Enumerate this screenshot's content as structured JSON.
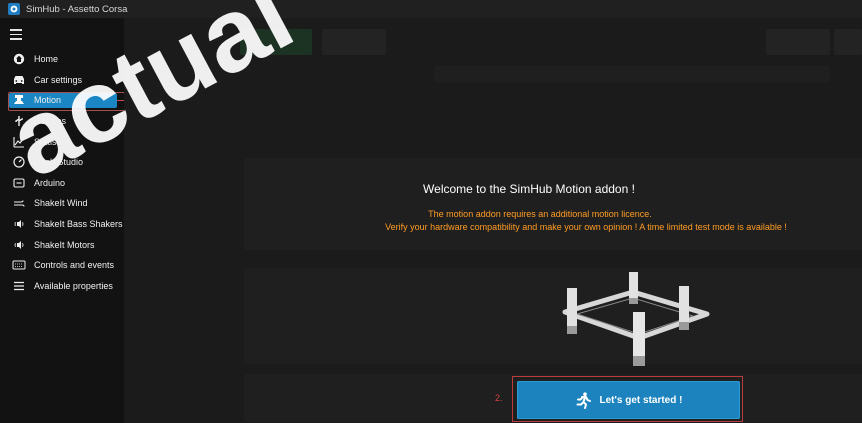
{
  "window": {
    "title": "SimHub - Assetto Corsa"
  },
  "sidebar": {
    "items": [
      {
        "label": "Home",
        "icon": "home-icon"
      },
      {
        "label": "Car settings",
        "icon": "car-icon"
      },
      {
        "label": "Motion",
        "icon": "motion-icon",
        "active": true
      },
      {
        "label": "Devices",
        "icon": "usb-icon"
      },
      {
        "label": "Statistics",
        "icon": "statistics-icon"
      },
      {
        "label": "Dash Studio",
        "icon": "dash-icon"
      },
      {
        "label": "Arduino",
        "icon": "arduino-icon"
      },
      {
        "label": "ShakeIt Wind",
        "icon": "wind-icon"
      },
      {
        "label": "ShakeIt Bass Shakers",
        "icon": "speaker-icon"
      },
      {
        "label": "ShakeIt Motors",
        "icon": "motor-icon"
      },
      {
        "label": "Controls and events",
        "icon": "keyboard-icon"
      },
      {
        "label": "Available properties",
        "icon": "list-icon"
      }
    ]
  },
  "overlay": {
    "welcome_title": "Welcome to the SimHub Motion addon !",
    "licence_note": "The motion addon requires an additional motion licence.",
    "verify_note": "Verify your hardware compatibility and make your own opinion ! A time limited test mode is available !",
    "start_button": "Let's get started !",
    "step_number": "2."
  },
  "watermark": {
    "text": "actual"
  },
  "colors": {
    "accent": "#1a86c4",
    "orange_text": "#ff9c24",
    "annotation_red": "#c34b4b"
  }
}
